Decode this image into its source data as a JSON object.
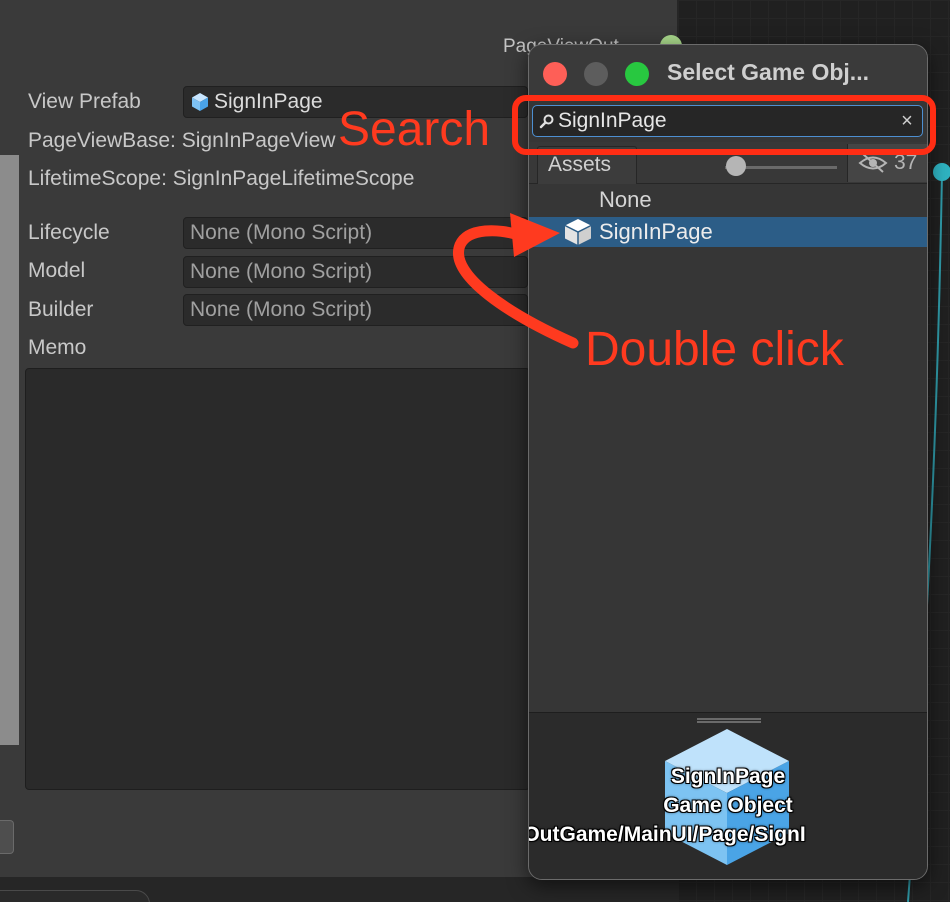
{
  "inspector": {
    "port_label": "PageViewOut",
    "view_prefab_label": "View Prefab",
    "view_prefab_value": "SignInPage",
    "page_view_base": "PageViewBase: SignInPageView",
    "lifetime_scope": "LifetimeScope: SignInPageLifetimeScope",
    "lifecycle_label": "Lifecycle",
    "lifecycle_value": "None (Mono Script)",
    "model_label": "Model",
    "model_value": "None (Mono Script)",
    "builder_label": "Builder",
    "builder_value": "None (Mono Script)",
    "memo_label": "Memo"
  },
  "picker": {
    "title": "Select Game Obj...",
    "search_value": "SignInPage",
    "clear_icon": "×",
    "tab_assets": "Assets",
    "hidden_count": "37",
    "items": [
      {
        "label": "None"
      },
      {
        "label": "SignInPage",
        "icon": "prefab-cube-icon",
        "selected": true
      }
    ],
    "preview": {
      "name": "SignInPage",
      "type": "Game Object",
      "path": "os/OutGame/MainUI/Page/SignI"
    }
  },
  "annotations": {
    "search": "Search",
    "double_click": "Double click",
    "color": "#ff3a1f"
  },
  "colors": {
    "selection": "#2c5d87",
    "search_focus": "#4d8fd1",
    "close": "#fe5f57",
    "maximize": "#28c840"
  }
}
